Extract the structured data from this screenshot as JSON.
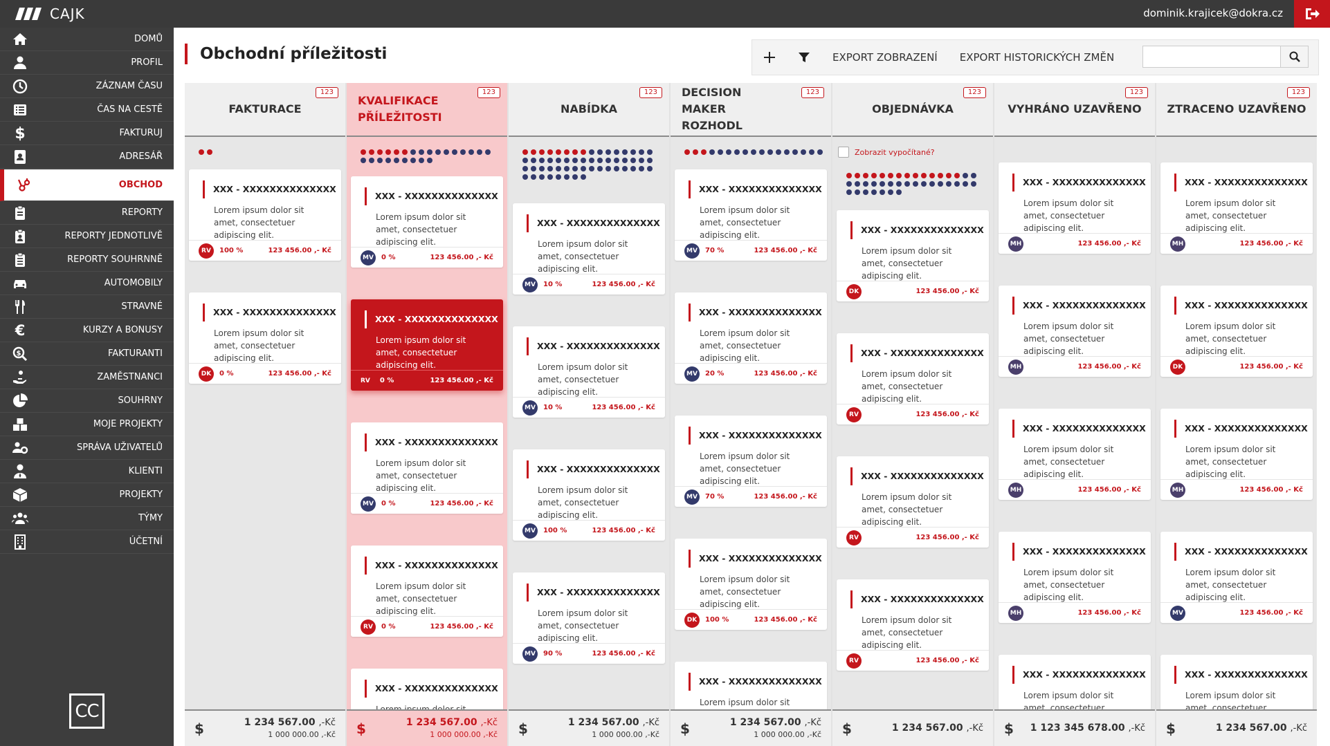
{
  "topbar": {
    "app_name": "CAJK",
    "email": "dominik.krajicek@dokra.cz"
  },
  "nav": [
    {
      "label": "Domů",
      "icon": "home-icon"
    },
    {
      "label": "Profil",
      "icon": "user-icon"
    },
    {
      "label": "Záznam času",
      "icon": "clock-icon"
    },
    {
      "label": "Čas na cestě",
      "icon": "list-icon"
    },
    {
      "label": "Fakturuj",
      "icon": "dollar-icon"
    },
    {
      "label": "Adresář",
      "icon": "address-book-icon"
    },
    {
      "label": "Obchod",
      "icon": "hubspot-icon",
      "active": true
    },
    {
      "label": "Reporty",
      "icon": "clipboard-icon"
    },
    {
      "label": "Reporty jednotlivě",
      "icon": "clipboard-user-icon"
    },
    {
      "label": "Reporty souhrnně",
      "icon": "clipboard-list-icon"
    },
    {
      "label": "Automobily",
      "icon": "car-icon"
    },
    {
      "label": "Stravné",
      "icon": "cutlery-icon"
    },
    {
      "label": "Kurzy a bonusy",
      "icon": "euro-icon"
    },
    {
      "label": "Fakturanti",
      "icon": "search-dollar-icon"
    },
    {
      "label": "Zaměstnanci",
      "icon": "hand-holding-icon"
    },
    {
      "label": "Souhrny",
      "icon": "pie-chart-icon"
    },
    {
      "label": "Moje projekty",
      "icon": "cubes-icon"
    },
    {
      "label": "Správa uživatelů",
      "icon": "users-cog-icon"
    },
    {
      "label": "Klienti",
      "icon": "user-tie-icon"
    },
    {
      "label": "Projekty",
      "icon": "box-icon"
    },
    {
      "label": "Týmy",
      "icon": "users-icon"
    },
    {
      "label": "Účetní",
      "icon": "building-icon"
    }
  ],
  "page": {
    "title": "Obchodní příležitosti"
  },
  "toolbar": {
    "add": "+",
    "export_view": "EXPORT ZOBRAZENÍ",
    "export_history": "EXPORT HISTORICKÝCH ZMĚN",
    "search_placeholder": ""
  },
  "colors": {
    "accent": "#c4161c",
    "dark": "#3d3d3d",
    "navy": "#333a6b",
    "mh": "#4a3f6b"
  },
  "card_text": {
    "title": "XXX - XXXXXXXXXXXXXX",
    "desc": "Lorem ipsum dolor sit amet, consectetuer adipiscing elit."
  },
  "columns": [
    {
      "title": "FAKTURACE",
      "badge": "123",
      "dots": "rr",
      "cards": [
        {
          "av": "RV",
          "pct": "100 %",
          "price": "123 456.00 ,- Kč"
        },
        {
          "av": "DK",
          "pct": "0 %",
          "price": "123 456.00 ,- Kč"
        }
      ],
      "sum1": "1 234 567.00",
      "sum1_unit": ",-Kč",
      "sum2": "1 000 000.00 ,-Kč"
    },
    {
      "title": "KVALIFIKACE PŘÍLEŽITOSTI",
      "badge": "123",
      "hl": true,
      "dots": "rrrrrrbbbbbbbbbbbbbbbbbbb",
      "cards": [
        {
          "av": "MV",
          "pct": "0 %",
          "price": "123 456.00 ,- Kč"
        },
        {
          "av": "RV",
          "pct": "0 %",
          "price": "123 456.00 ,- Kč",
          "active": true
        },
        {
          "av": "MV",
          "pct": "0 %",
          "price": "123 456.00 ,- Kč"
        },
        {
          "av": "RV",
          "pct": "0 %",
          "price": "123 456.00 ,- Kč"
        },
        {
          "av": "",
          "pct": "",
          "price": ""
        }
      ],
      "sum1": "1 234 567.00",
      "sum1_unit": ",-Kč",
      "sum2": "1 000 000.00 ,-Kč"
    },
    {
      "title": "NABÍDKA",
      "badge": "123",
      "dots": "rrrrrrrrbbbbbbbbbbbbbbbbbbbbbbbbbbbbbbbbbbbbbbbbbbbbbbbb",
      "cards": [
        {
          "av": "MV",
          "pct": "10 %",
          "price": "123 456.00 ,- Kč"
        },
        {
          "av": "MV",
          "pct": "10 %",
          "price": "123 456.00 ,- Kč"
        },
        {
          "av": "MV",
          "pct": "100 %",
          "price": "123 456.00 ,- Kč"
        },
        {
          "av": "MV",
          "pct": "90 %",
          "price": "123 456.00 ,- Kč"
        }
      ],
      "sum1": "1 234 567.00",
      "sum1_unit": ",-Kč",
      "sum2": "1 000 000.00 ,-Kč"
    },
    {
      "title": "DECISION MAKER ROZHODL",
      "badge": "123",
      "dots": "rrrbbbbbbbbbbbbbb",
      "cards": [
        {
          "av": "MV",
          "pct": "70 %",
          "price": "123 456.00 ,- Kč"
        },
        {
          "av": "MV",
          "pct": "20 %",
          "price": "123 456.00 ,- Kč"
        },
        {
          "av": "MV",
          "pct": "70 %",
          "price": "123 456.00 ,- Kč"
        },
        {
          "av": "DK",
          "pct": "100 %",
          "price": "123 456.00 ,- Kč"
        },
        {
          "av": "",
          "pct": "",
          "price": ""
        }
      ],
      "sum1": "1 234 567.00",
      "sum1_unit": ",-Kč",
      "sum2": "1 000 000.00 ,-Kč"
    },
    {
      "title": "OBJEDNÁVKA",
      "badge": "123",
      "show_calc": "Zobrazit vypočítané?",
      "dots": "rrrrrrrrrrrrrrbbbbbbbbbbbbbbbbbbbbbbbbb",
      "cards": [
        {
          "av": "DK",
          "pct": "",
          "price": "123 456.00 ,- Kč"
        },
        {
          "av": "RV",
          "pct": "",
          "price": "123 456.00 ,- Kč"
        },
        {
          "av": "RV",
          "pct": "",
          "price": "123 456.00 ,- Kč"
        },
        {
          "av": "RV",
          "pct": "",
          "price": "123 456.00 ,- Kč"
        }
      ],
      "sum1": "1 234 567.00",
      "sum1_unit": ",-Kč",
      "sum2": ""
    },
    {
      "title": "VYHRÁNO UZAVŘENO",
      "badge": "123",
      "dots": "",
      "cards": [
        {
          "av": "MH",
          "pct": "",
          "price": "123 456.00 ,- Kč"
        },
        {
          "av": "MH",
          "pct": "",
          "price": "123 456.00 ,- Kč"
        },
        {
          "av": "MH",
          "pct": "",
          "price": "123 456.00 ,- Kč"
        },
        {
          "av": "MH",
          "pct": "",
          "price": "123 456.00 ,- Kč"
        },
        {
          "av": "",
          "pct": "",
          "price": ""
        }
      ],
      "sum1": "1 123 345 678.00",
      "sum1_unit": ",-Kč",
      "sum2": ""
    },
    {
      "title": "ZTRACENO UZAVŘENO",
      "badge": "123",
      "dots": "",
      "cards": [
        {
          "av": "MH",
          "pct": "",
          "price": "123 456.00 ,- Kč"
        },
        {
          "av": "DK",
          "pct": "",
          "price": "123 456.00 ,- Kč"
        },
        {
          "av": "MH",
          "pct": "",
          "price": "123 456.00 ,- Kč"
        },
        {
          "av": "MV",
          "pct": "",
          "price": "123 456.00 ,- Kč"
        },
        {
          "av": "",
          "pct": "",
          "price": ""
        }
      ],
      "sum1": "1 234 567.00",
      "sum1_unit": ",-Kč",
      "sum2": ""
    }
  ]
}
